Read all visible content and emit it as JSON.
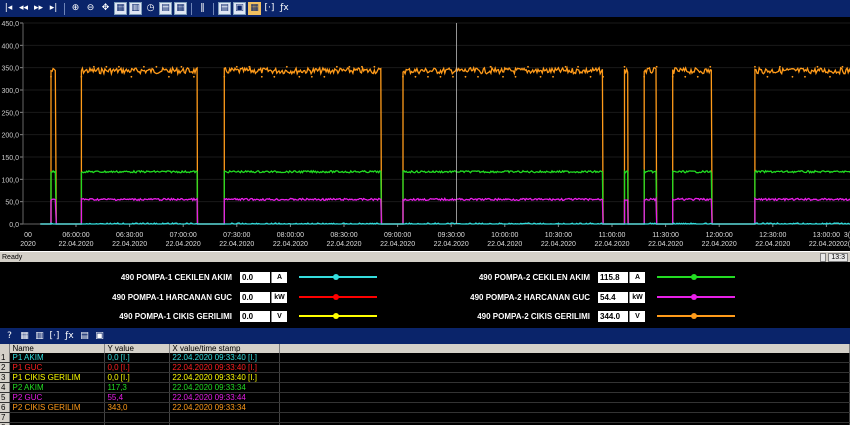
{
  "toolbar_icons": [
    {
      "name": "first-icon",
      "glyph": "|◂",
      "style": "plain"
    },
    {
      "name": "rewind-icon",
      "glyph": "◂◂",
      "style": "plain"
    },
    {
      "name": "forward-icon",
      "glyph": "▸▸",
      "style": "plain"
    },
    {
      "name": "last-icon",
      "glyph": "▸|",
      "style": "plain"
    },
    {
      "name": "sep"
    },
    {
      "name": "zoom-in-icon",
      "glyph": "⊕",
      "style": "plain"
    },
    {
      "name": "zoom-out-icon",
      "glyph": "⊖",
      "style": "plain"
    },
    {
      "name": "pan-icon",
      "glyph": "✥",
      "style": "plain"
    },
    {
      "name": "zoom-box-icon",
      "glyph": "▦",
      "style": "sq"
    },
    {
      "name": "zoom-area-icon",
      "glyph": "▥",
      "style": "sq"
    },
    {
      "name": "clock-icon",
      "glyph": "◷",
      "style": "plain"
    },
    {
      "name": "ruler-icon",
      "glyph": "▤",
      "style": "sq"
    },
    {
      "name": "grid-icon",
      "glyph": "▦",
      "style": "sq"
    },
    {
      "name": "sep"
    },
    {
      "name": "pause-icon",
      "glyph": "‖",
      "style": "plain"
    },
    {
      "name": "sep"
    },
    {
      "name": "print-icon",
      "glyph": "▤",
      "style": "sq"
    },
    {
      "name": "export-icon",
      "glyph": "▣",
      "style": "sq"
    },
    {
      "name": "config-icon",
      "glyph": "▦",
      "style": "hl"
    },
    {
      "name": "bracket-icon",
      "glyph": "[·]",
      "style": "plain"
    },
    {
      "name": "fx-icon",
      "glyph": "ƒx",
      "style": "plain"
    }
  ],
  "chart_data": {
    "type": "line",
    "y_ticks": [
      "450,0",
      "400,0",
      "350,0",
      "300,0",
      "250,0",
      "200,0",
      "150,0",
      "100,0",
      "50,0",
      "0,0"
    ],
    "ylim": [
      0,
      450
    ],
    "x_ticks": [
      {
        "time": "06:00:00",
        "date": "22.04.2020"
      },
      {
        "time": "06:30:00",
        "date": "22.04.2020"
      },
      {
        "time": "07:00:00",
        "date": "22.04.2020"
      },
      {
        "time": "07:30:00",
        "date": "22.04.2020"
      },
      {
        "time": "08:00:00",
        "date": "22.04.2020"
      },
      {
        "time": "08:30:00",
        "date": "22.04.2020"
      },
      {
        "time": "09:00:00",
        "date": "22.04.2020"
      },
      {
        "time": "09:30:00",
        "date": "22.04.2020"
      },
      {
        "time": "10:00:00",
        "date": "22.04.2020"
      },
      {
        "time": "10:30:00",
        "date": "22.04.2020"
      },
      {
        "time": "11:00:00",
        "date": "22.04.2020"
      },
      {
        "time": "11:30:00",
        "date": "22.04.2020"
      },
      {
        "time": "12:00:00",
        "date": "22.04.2020"
      },
      {
        "time": "12:30:00",
        "date": "22.04.2020"
      },
      {
        "time": "13:00:00",
        "date": "22.04.2020"
      }
    ],
    "edge_ticks": {
      "left_time": "00",
      "left_date": "2020",
      "right_time": "3(",
      "right_date": "2("
    },
    "run_intervals": [
      [
        "05:46",
        "05:49"
      ],
      [
        "06:03",
        "07:08"
      ],
      [
        "07:23",
        "08:51"
      ],
      [
        "09:03",
        "10:55"
      ],
      [
        "11:07",
        "11:09"
      ],
      [
        "11:18",
        "11:25"
      ],
      [
        "11:34",
        "11:56"
      ],
      [
        "12:20",
        "13:16"
      ]
    ],
    "series": [
      {
        "name": "P2 CIKIS GERILIM",
        "color": "#ff9b1a",
        "on": 343,
        "off": 0
      },
      {
        "name": "P2 AKIM",
        "color": "#22dd22",
        "on": 117,
        "off": 0
      },
      {
        "name": "P2 GUC",
        "color": "#e81ee8",
        "on": 55,
        "off": 0
      },
      {
        "name": "P1 AKIM",
        "color": "#33dddd",
        "on": 0,
        "off": 0
      }
    ],
    "cursor_time": "09:33:40",
    "grid": true
  },
  "status": {
    "left": "Ready",
    "right": "13:3"
  },
  "legend": [
    {
      "label": "490 POMPA-1 CEKILEN AKIM",
      "value": "0.0",
      "unit": "A",
      "color": "#33dddd"
    },
    {
      "label": "490 POMPA-1 HARCANAN GUC",
      "value": "0.0",
      "unit": "kW",
      "color": "#ff0000"
    },
    {
      "label": "490 POMPA-1 CIKIS GERILIMI",
      "value": "0.0",
      "unit": "V",
      "color": "#ffff00"
    },
    {
      "label": "490 POMPA-2 CEKILEN AKIM",
      "value": "115.8",
      "unit": "A",
      "color": "#22dd22"
    },
    {
      "label": "490 POMPA-2 HARCANAN GUC",
      "value": "54.4",
      "unit": "kW",
      "color": "#e81ee8"
    },
    {
      "label": "490 POMPA-2 CIKIS GERILIMI",
      "value": "344.0",
      "unit": "V",
      "color": "#ff9b1a"
    }
  ],
  "bottom_icons": [
    {
      "name": "help-icon",
      "glyph": "?"
    },
    {
      "name": "table-icon",
      "glyph": "▦"
    },
    {
      "name": "grid-select-icon",
      "glyph": "▥"
    },
    {
      "name": "bracket-icon",
      "glyph": "[·]"
    },
    {
      "name": "fx-icon",
      "glyph": "ƒx"
    },
    {
      "name": "print-icon",
      "glyph": "▤"
    },
    {
      "name": "export-icon",
      "glyph": "▣"
    }
  ],
  "table": {
    "columns": [
      "Name",
      "Y value",
      "X value/time stamp"
    ],
    "rows": [
      {
        "idx": "1",
        "name": "P1 AKIM",
        "y": "0,0 [I.]",
        "x": "22.04.2020 09:33:40 [I.]",
        "color": "#33dddd"
      },
      {
        "idx": "2",
        "name": "P1 GUC",
        "y": "0,0 [I.]",
        "x": "22.04.2020 09:33:40 [I.]",
        "color": "#ff2020"
      },
      {
        "idx": "3",
        "name": "P1 CIKIS GERILIM",
        "y": "0,0 [I.]",
        "x": "22.04.2020 09:33:40 [I.]",
        "color": "#ffff00"
      },
      {
        "idx": "4",
        "name": "P2 AKIM",
        "y": "117,3",
        "x": "22.04.2020 09:33:34",
        "color": "#22dd22"
      },
      {
        "idx": "5",
        "name": "P2 GUC",
        "y": "55,4",
        "x": "22.04.2020 09:33:44",
        "color": "#e81ee8"
      },
      {
        "idx": "6",
        "name": "P2 CIKIS GERILIM",
        "y": "343,0",
        "x": "22.04.2020 09:33:34",
        "color": "#ff9b1a"
      },
      {
        "idx": "7",
        "name": "",
        "y": "",
        "x": "",
        "color": "#fff"
      },
      {
        "idx": "8",
        "name": "",
        "y": "",
        "x": "",
        "color": "#fff"
      }
    ]
  }
}
